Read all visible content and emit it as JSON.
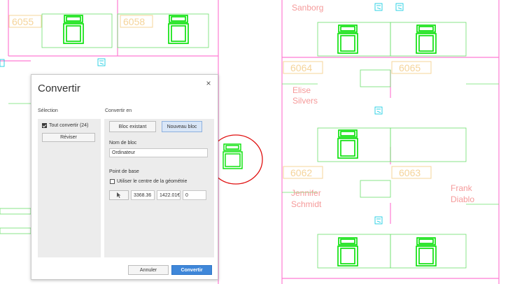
{
  "drawing": {
    "room_numbers": [
      "6055",
      "6058",
      "6064",
      "6065",
      "6062",
      "6063"
    ],
    "names": {
      "sanborg": "Sanborg",
      "elise_first": "Elise",
      "elise_last": "Silvers",
      "jennifer_first": "Jennifer",
      "jennifer_last": "Schmidt",
      "frank_first": "Frank",
      "frank_last": "Diablo"
    }
  },
  "dialog": {
    "title": "Convertir",
    "close_glyph": "×",
    "selection_label": "Sélection",
    "convert_all_label": "Tout convertir (24)",
    "convert_all_checked": true,
    "review_button": "Réviser",
    "convert_to_label": "Convertir en",
    "existing_block_button": "Bloc existant",
    "new_block_button": "Nouveau bloc",
    "block_name_label": "Nom de bloc",
    "block_name_value": "Ordinateur",
    "base_point_label": "Point de base",
    "use_geometry_center_label": "Utiliser le centre de la géométrie",
    "use_geometry_center_checked": false,
    "coord_x": "3368.36",
    "coord_y": "1422.01€",
    "coord_z": "0",
    "cancel_button": "Annuler",
    "convert_button": "Convertir"
  },
  "colors": {
    "cad_green": "#00e000",
    "cad_magenta": "#ff7bd3",
    "cad_cyan": "#00c8e0",
    "room_tag": "#f5d49a",
    "name_text": "#f59a9a",
    "annotation_red": "#e01010",
    "accent_blue": "#3f87d9"
  }
}
